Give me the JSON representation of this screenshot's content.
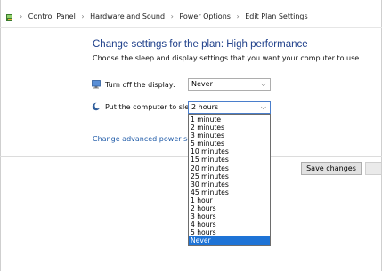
{
  "breadcrumb": {
    "items": [
      "Control Panel",
      "Hardware and Sound",
      "Power Options",
      "Edit Plan Settings"
    ],
    "separator": "›"
  },
  "page": {
    "title": "Change settings for the plan: High performance",
    "subtitle": "Choose the sleep and display settings that you want your computer to use."
  },
  "settings": {
    "display": {
      "label": "Turn off the display:",
      "value": "Never"
    },
    "sleep": {
      "label": "Put the computer to sleep:",
      "value": "2 hours"
    }
  },
  "sleep_options": [
    "1 minute",
    "2 minutes",
    "3 minutes",
    "5 minutes",
    "10 minutes",
    "15 minutes",
    "20 minutes",
    "25 minutes",
    "30 minutes",
    "45 minutes",
    "1 hour",
    "2 hours",
    "3 hours",
    "4 hours",
    "5 hours",
    "Never"
  ],
  "sleep_highlighted": "Never",
  "advanced_link": "Change advanced power settings",
  "buttons": {
    "save": "Save changes"
  },
  "colors": {
    "heading": "#1e3f8a",
    "link": "#1e5aa8",
    "selection": "#1e73d6"
  }
}
